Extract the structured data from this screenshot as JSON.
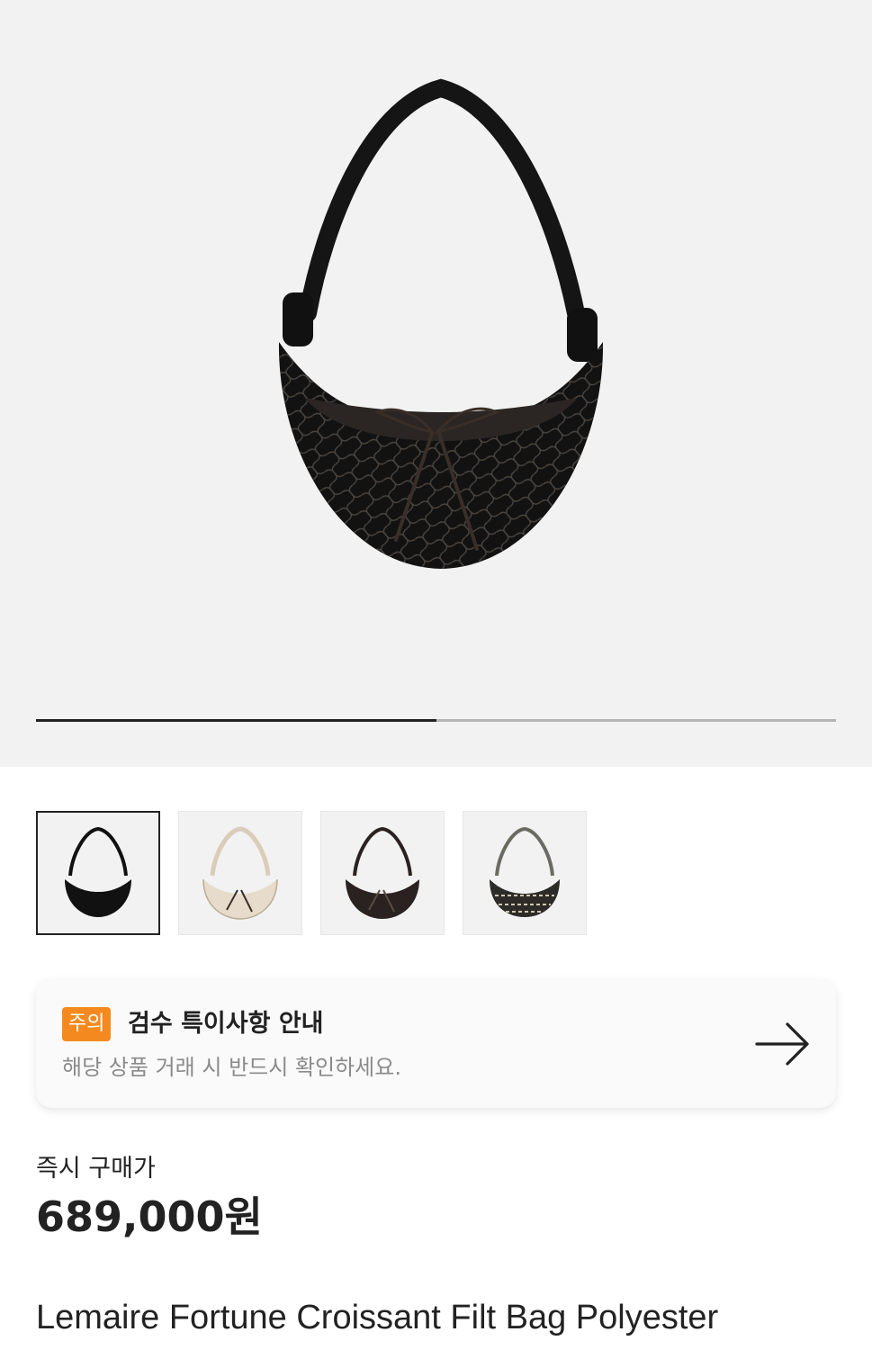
{
  "hero": {
    "image_icon": "black-net-croissant-bag",
    "slide_progress": 0.5
  },
  "thumbnails": [
    {
      "icon": "black-bag-thumbnail",
      "color": "#111111",
      "selected": true
    },
    {
      "icon": "beige-bag-thumbnail",
      "color": "#e7dccb",
      "selected": false
    },
    {
      "icon": "dark-brown-bag-thumbnail",
      "color": "#2a2220",
      "selected": false
    },
    {
      "icon": "grey-pattern-bag-thumbnail",
      "color": "#6b6a63",
      "selected": false
    }
  ],
  "notice": {
    "badge": "주의",
    "title": "검수 특이사항 안내",
    "subtitle": "해당 상품 거래 시 반드시 확인하세요.",
    "arrow_icon": "arrow-right-icon"
  },
  "price": {
    "label": "즉시 구매가",
    "value": "689,000원"
  },
  "product": {
    "name": "Lemaire Fortune Croissant Filt Bag Polyester"
  },
  "colors": {
    "badge": "#f48a1f",
    "hero_background": "#f2f2f2",
    "text": "#222222",
    "subtext": "#8a8a8a"
  }
}
